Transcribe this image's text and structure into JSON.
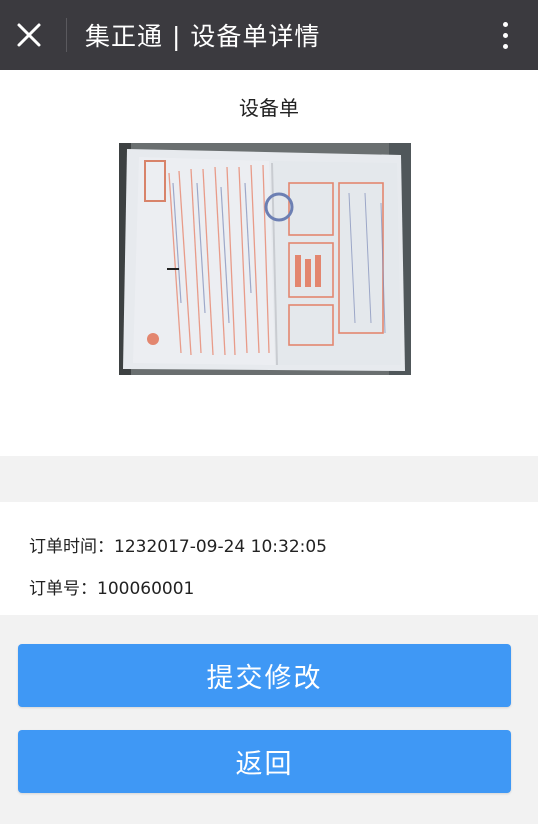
{
  "header": {
    "title": "集正通 | 设备单详情",
    "close_icon": "close-icon",
    "more_icon": "more-vertical-icon"
  },
  "document": {
    "label": "设备单"
  },
  "order": {
    "time_label": "订单时间：",
    "time_value": "1232017-09-24 10:32:05",
    "number_label": "订单号：",
    "number_value": "100060001"
  },
  "actions": {
    "submit_label": "提交修改",
    "back_label": "返回"
  },
  "colors": {
    "header_bg": "#3b3a3f",
    "button_blue": "#3f98f5",
    "page_bg": "#f2f2f2"
  }
}
